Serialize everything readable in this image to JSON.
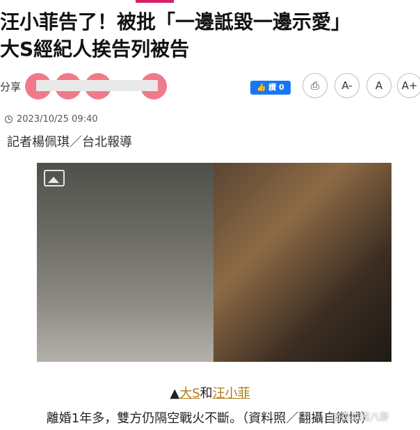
{
  "title_line1": "汪小菲告了！被批「一邊詆毀一邊示愛」",
  "title_line2": "大S經紀人挨告列被告",
  "share": {
    "label": "分享",
    "like_label": "讚 0"
  },
  "buttons": {
    "print": "⎙",
    "font_smaller": "A-",
    "font_reset": "A",
    "font_larger": "A+"
  },
  "date": "2023/10/25 09:40",
  "reporter": "記者楊佩琪／台北報導",
  "caption": {
    "prefix": "▲",
    "link1": "大S",
    "mid1": "和",
    "link2": "汪小菲",
    "rest": "離婚1年多，雙方仍隔空戰火不斷。（資料照／翻攝自微博）"
  },
  "watermark": "@森森说八卦",
  "colors": {
    "accent": "#d61f69",
    "link": "#b07a19",
    "fb_blue": "#1877f2"
  }
}
